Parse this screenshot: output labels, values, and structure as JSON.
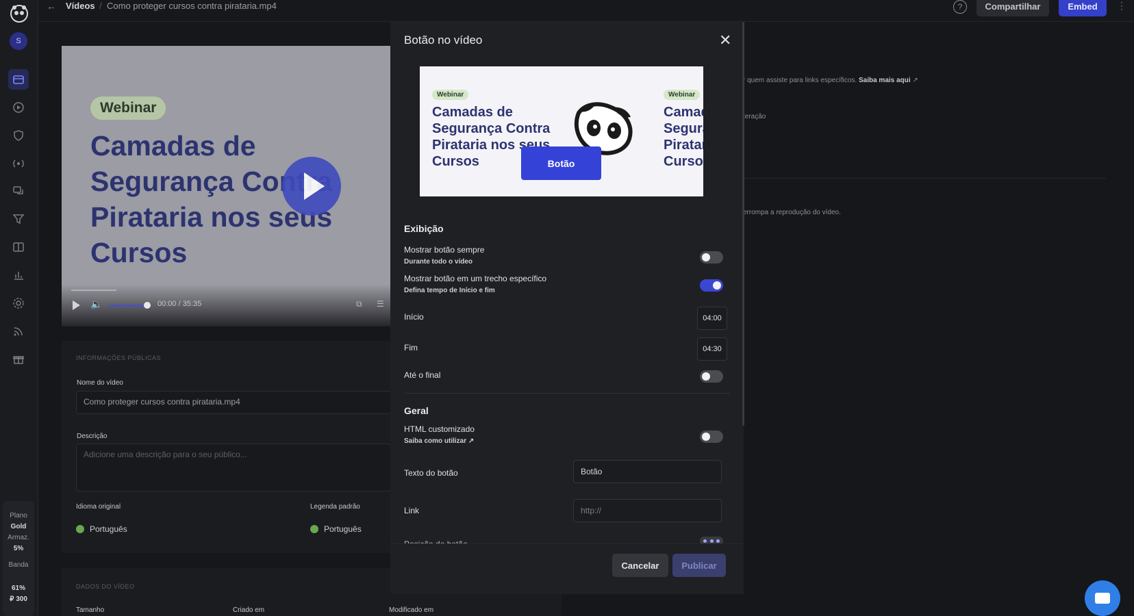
{
  "topbar": {
    "back_icon": "←",
    "breadcrumb_root": "Vídeos",
    "breadcrumb_sep": "/",
    "breadcrumb_file": "Como proteger cursos contra pirataria.mp4",
    "help_label": "?",
    "share_label": "Compartilhar",
    "embed_label": "Embed",
    "more_label": "⋮"
  },
  "sidebar": {
    "avatar_initial": "S",
    "nav_icons": [
      "videos-icon",
      "play-icon",
      "shield-icon",
      "broadcast-icon",
      "comments-icon",
      "funnel-icon",
      "ab-test-icon",
      "analytics-icon",
      "settings-icon",
      "rss-icon",
      "gift-icon"
    ],
    "plan_label": "Plano",
    "plan_name": "Gold",
    "storage_label": "Armaz.",
    "storage_value": "5%",
    "bandwidth_label": "Banda",
    "bandwidth_value": "61%",
    "credits_value": "₽ 300"
  },
  "player": {
    "tag": "Webinar",
    "title": "Camadas de Segurança Contra Pirataria nos seus Cursos",
    "time_current": "00:00",
    "time_sep": "/",
    "time_total": "35:35",
    "volume_fraction": 0.8
  },
  "public_info": {
    "section_caption": "INFORMAÇÕES PÚBLICAS",
    "name_label": "Nome do vídeo",
    "name_value": "Como proteger cursos contra pirataria.mp4",
    "description_label": "Descrição",
    "description_placeholder": "Adicione uma descrição para o seu público...",
    "original_language_label": "Idioma original",
    "original_language_value": "Português",
    "default_subtitle_label": "Legenda padrão",
    "default_subtitle_value": "Português"
  },
  "video_data": {
    "section_caption": "DADOS DO VÍDEO",
    "size_label": "Tamanho",
    "created_label": "Criado em",
    "modified_label": "Modificado em"
  },
  "background_texts": {
    "line1": "r quem assiste para links específicos.",
    "line1_link": "Saiba mais aqui",
    "line2": "teração",
    "line3": "errompa a reprodução do vídeo."
  },
  "modal": {
    "title": "Botão no vídeo",
    "close_label": "✕",
    "preview": {
      "tag": "Webinar",
      "title": "Camadas de Segurança Contra Pirataria nos seus Cursos",
      "button_label": "Botão"
    },
    "display": {
      "section_title": "Exibição",
      "always_label": "Mostrar botão sempre",
      "always_sub": "Durante todo o vídeo",
      "always_on": false,
      "segment_label": "Mostrar botão em um trecho específico",
      "segment_sub": "Defina tempo de Início e fim",
      "segment_on": true,
      "start_label": "Início",
      "start_value": "04:00",
      "end_label": "Fim",
      "end_value": "04:30",
      "until_end_label": "Até o final",
      "until_end_on": false
    },
    "general": {
      "section_title": "Geral",
      "custom_html_label": "HTML customizado",
      "custom_html_sub": "Saiba como utilizar",
      "custom_html_on": false,
      "button_text_label": "Texto do botão",
      "button_text_value": "Botão",
      "link_label": "Link",
      "link_placeholder": "http://",
      "position_label": "Posição do botão"
    },
    "footer": {
      "cancel_label": "Cancelar",
      "publish_label": "Publicar"
    }
  },
  "colors": {
    "accent": "#3442d8",
    "background": "#16171b",
    "modal": "#1f2024"
  }
}
